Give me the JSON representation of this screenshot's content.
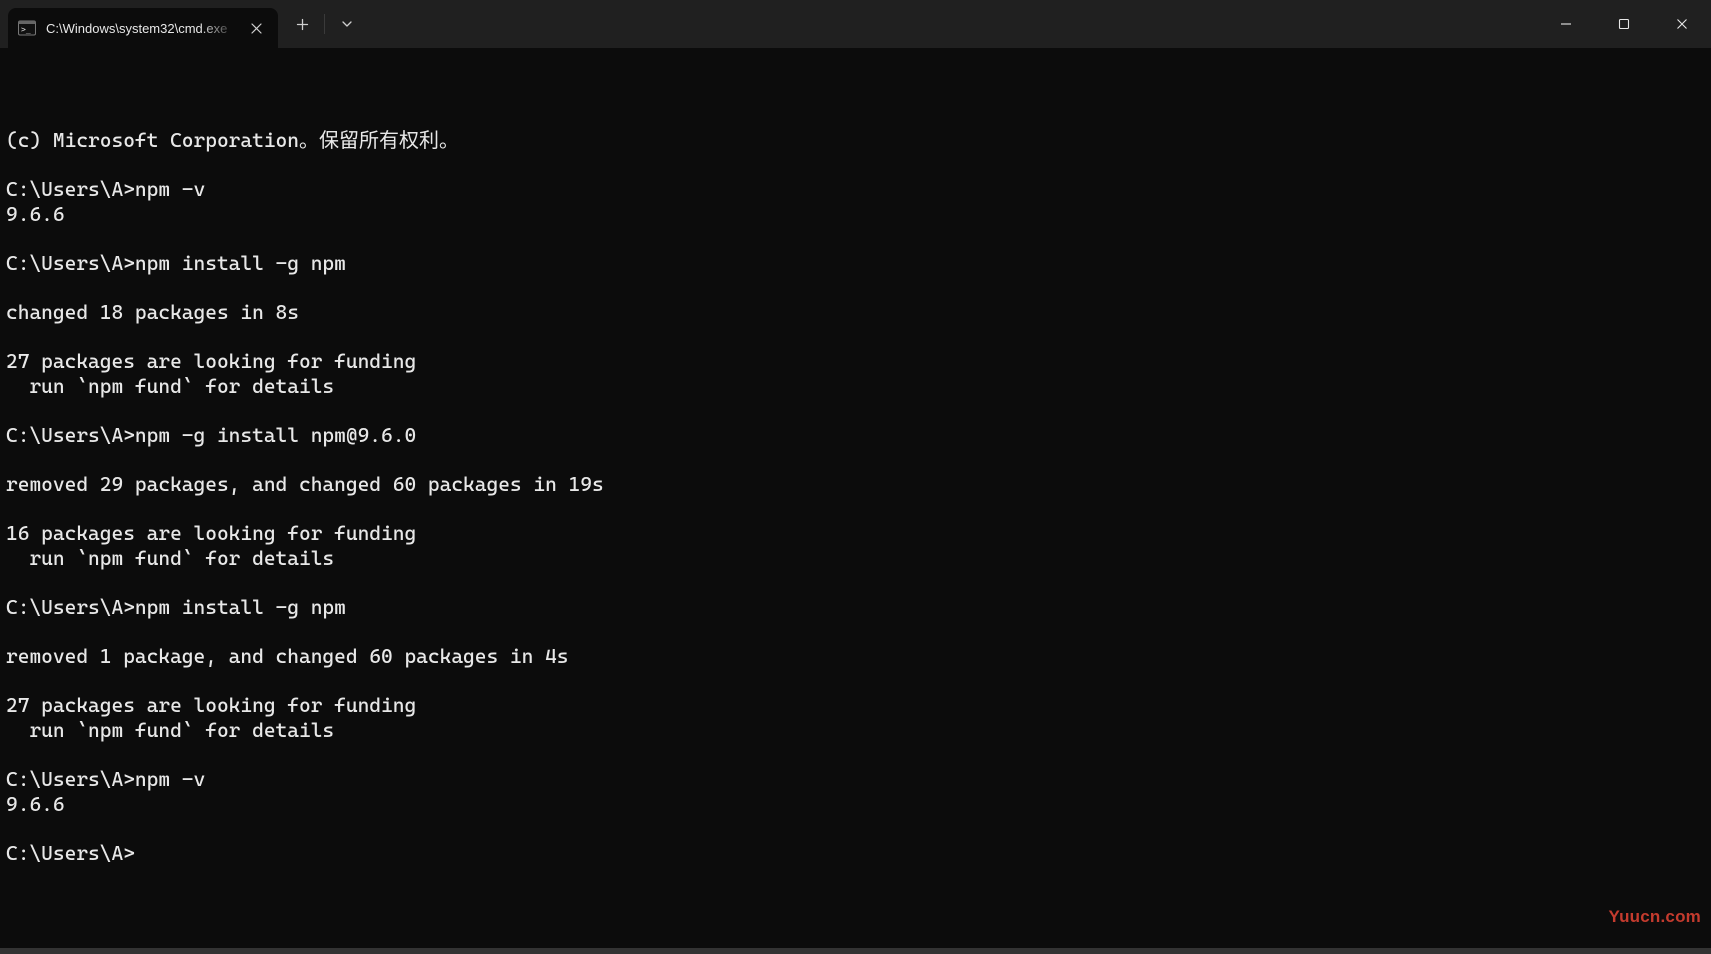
{
  "titlebar": {
    "tab": {
      "title": "C:\\Windows\\system32\\cmd.exe",
      "icon": "cmd-icon"
    },
    "controls": {
      "new_tab": "plus-icon",
      "dropdown": "chevron-down-icon"
    },
    "window": {
      "minimize": "minimize-icon",
      "maximize": "maximize-icon",
      "close": "close-icon"
    }
  },
  "terminal": {
    "lines": [
      "(c) Microsoft Corporation。保留所有权利。",
      "",
      "C:\\Users\\A>npm -v",
      "9.6.6",
      "",
      "C:\\Users\\A>npm install -g npm",
      "",
      "changed 18 packages in 8s",
      "",
      "27 packages are looking for funding",
      "  run `npm fund` for details",
      "",
      "C:\\Users\\A>npm -g install npm@9.6.0",
      "",
      "removed 29 packages, and changed 60 packages in 19s",
      "",
      "16 packages are looking for funding",
      "  run `npm fund` for details",
      "",
      "C:\\Users\\A>npm install -g npm",
      "",
      "removed 1 package, and changed 60 packages in 4s",
      "",
      "27 packages are looking for funding",
      "  run `npm fund` for details",
      "",
      "C:\\Users\\A>npm -v",
      "9.6.6",
      "",
      "C:\\Users\\A>"
    ]
  },
  "watermark": "Yuucn.com"
}
